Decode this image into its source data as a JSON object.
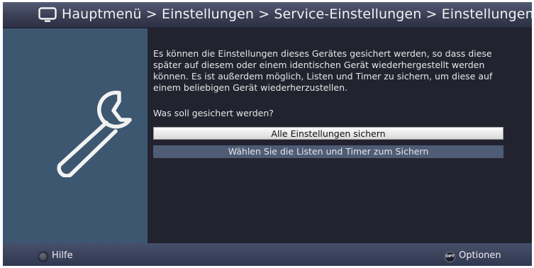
{
  "header": {
    "title": "Hauptmenü > Einstellungen > Service-Einstellungen > Einstellungen sichern",
    "icon": "tv-icon"
  },
  "sidebar": {
    "icon": "wrench-icon"
  },
  "main": {
    "description": "Es können die Einstellungen dieses Gerätes gesichert werden, so dass diese später auf diesem oder einem identischen Gerät wiederhergestellt werden können. Es ist außerdem möglich, Listen und Timer zu sichern, um diese auf einem beliebigen Gerät wiederherzustellen.",
    "question": "Was soll gesichert werden?",
    "options": [
      {
        "label": "Alle Einstellungen sichern",
        "selected": true
      },
      {
        "label": "Wählen Sie die Listen und Timer zum Sichern",
        "selected": false
      }
    ]
  },
  "footer": {
    "help_label": "Hilfe",
    "options_badge": "OPT",
    "options_label": "Optionen"
  },
  "colors": {
    "background": "#22232f",
    "sidebar": "#3d5771",
    "selected_option": "#ececec",
    "unselected_option": "#4e5c76"
  }
}
